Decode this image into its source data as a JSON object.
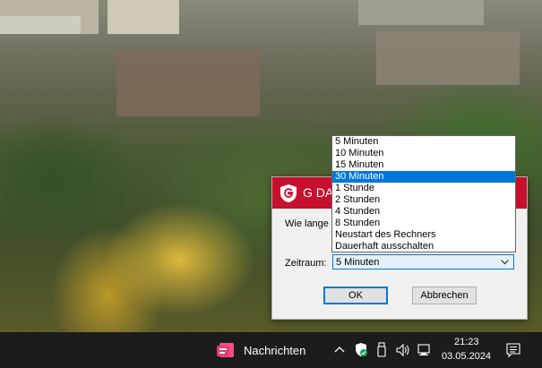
{
  "dialog": {
    "title": "G DA",
    "question": "Wie lange s",
    "zeitraum_label": "Zeitraum:",
    "selected_value": "5 Minuten",
    "ok_label": "OK",
    "cancel_label": "Abbrechen",
    "brand_color": "#c8102e"
  },
  "dropdown": {
    "options": [
      "5 Minuten",
      "10 Minuten",
      "15 Minuten",
      "30 Minuten",
      "1 Stunde",
      "2 Stunden",
      "4 Stunden",
      "8 Stunden",
      "Neustart des Rechners",
      "Dauerhaft ausschalten"
    ],
    "highlighted": "30 Minuten",
    "highlight_color": "#0078d7"
  },
  "taskbar": {
    "news_label": "Nachrichten",
    "time": "21:23",
    "date": "03.05.2024",
    "icons": [
      "chevron-up-icon",
      "defender-shield-icon",
      "usb-drive-icon",
      "speaker-icon",
      "network-icon",
      "notification-icon"
    ]
  }
}
